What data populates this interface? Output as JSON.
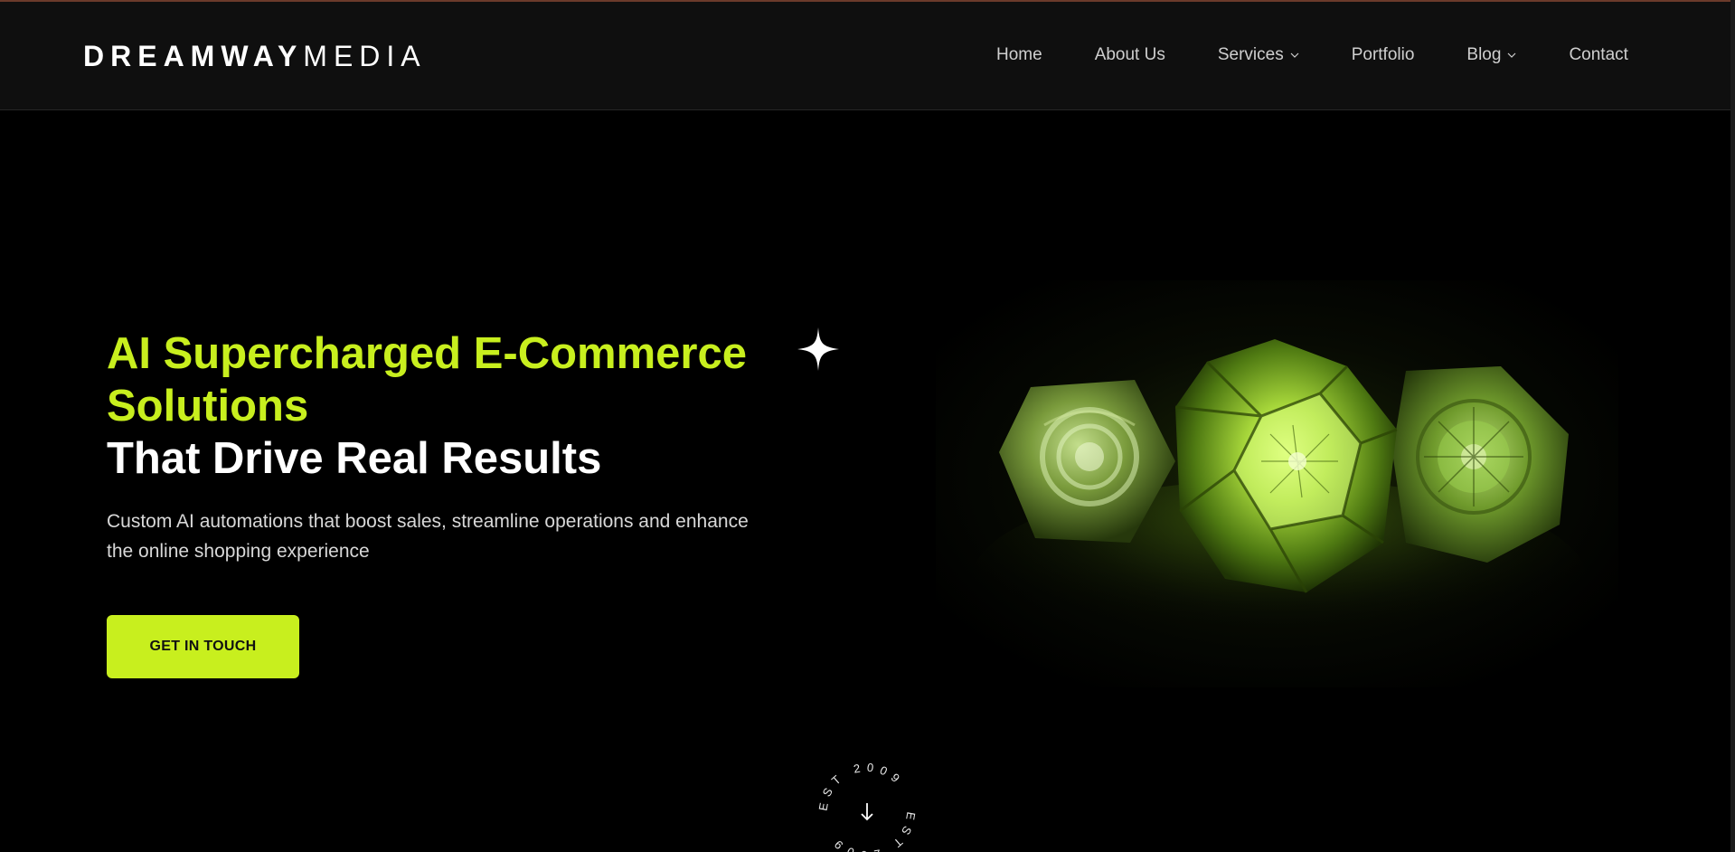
{
  "brand": {
    "logo_bold": "DREAMWAY",
    "logo_light": "MEDIA",
    "accent_color": "#c8ef1e"
  },
  "nav": {
    "items": [
      {
        "label": "Home",
        "has_dropdown": false
      },
      {
        "label": "About Us",
        "has_dropdown": false
      },
      {
        "label": "Services",
        "has_dropdown": true
      },
      {
        "label": "Portfolio",
        "has_dropdown": false
      },
      {
        "label": "Blog",
        "has_dropdown": true
      },
      {
        "label": "Contact",
        "has_dropdown": false
      }
    ]
  },
  "hero": {
    "headline_accent_line1": "AI Supercharged E-Commerce",
    "headline_accent_line2": "Solutions",
    "headline_white": "That Drive Real Results",
    "subtext_line1": "Custom AI automations that boost sales, streamline operations and enhance",
    "subtext_line2": "the online shopping experience",
    "cta_label": "GET IN TOUCH",
    "sparkle_icon": "four-point-star-icon",
    "image_icon": "glowing-green-polyhedra-image"
  },
  "badge": {
    "text": "EST 2009",
    "icon": "arrow-down-icon"
  }
}
